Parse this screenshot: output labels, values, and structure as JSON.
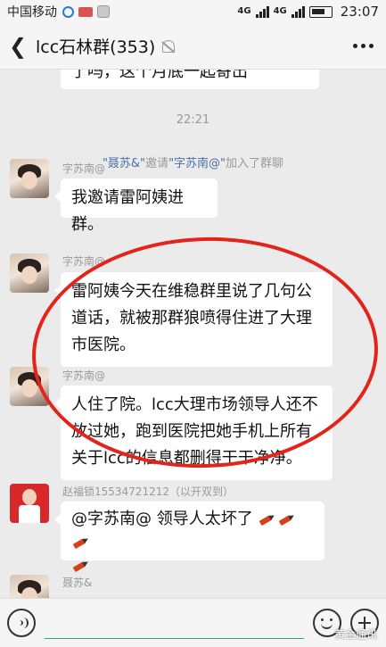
{
  "status_bar": {
    "carrier": "中国移动",
    "network_1": "4G",
    "network_2": "4G",
    "time": "23:07"
  },
  "header": {
    "title": "lcc石林群(353)"
  },
  "chat": {
    "prev_bubble_text": "了吗，这个月底一起寄出",
    "timestamp": "22:21",
    "system_message": {
      "inviter": "\"聂苏&\"",
      "verb": "邀请",
      "invitee": "\"字苏南@\"",
      "suffix": "加入了群聊"
    },
    "messages": [
      {
        "sender": "字苏南@",
        "text": "我邀请雷阿姨进群。"
      },
      {
        "sender": "字苏南@",
        "text": "雷阿姨今天在维稳群里说了几句公道话，就被那群狼喷得住进了大理市医院。"
      },
      {
        "sender": "字苏南@",
        "text": "人住了院。lcc大理市场领导人还不放过她，跑到医院把她手机上所有关于lcc的信息都删得干干净净。"
      },
      {
        "sender": "赵福锁15534721212（以开双到）",
        "text": "@字苏南@ 领导人太坏了"
      },
      {
        "sender": "聂苏&"
      }
    ]
  },
  "input": {
    "placeholder": ""
  },
  "watermark": "黄金通讯",
  "colors": {
    "annotation_ellipse": "#e2241b",
    "link": "#4a6fa5",
    "input_underline": "#2aae67"
  }
}
